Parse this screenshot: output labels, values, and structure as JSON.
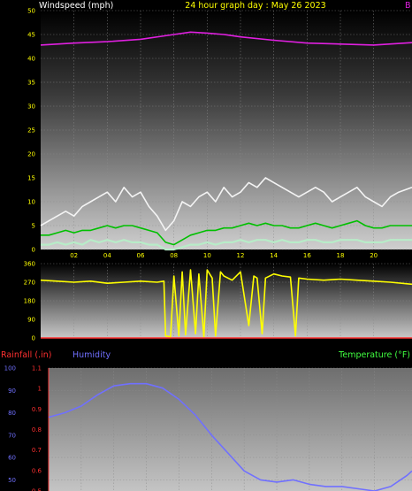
{
  "header": {
    "left_title": "Windspeed (mph)",
    "center_title": "24 hour graph day : May 26 2023",
    "right_fragment": "B"
  },
  "lower_header": {
    "rainfall_label": "Rainfall (.in)",
    "humidity_label": "Humidity",
    "temperature_label": "Temperature (°F)"
  },
  "colors": {
    "background": "#000000",
    "pressure": "#e020e0",
    "gust": "#f4f4f4",
    "average": "#00c000",
    "minimum": "#b8ecc8",
    "direction": "#ffff00",
    "humidity": "#7070ff",
    "rainfall": "#ff3030",
    "temperature": "#40ff40",
    "axis_text": "#ffff00"
  },
  "chart_data": [
    {
      "type": "line",
      "title": "24 hour graph day : May 26 2023",
      "ylabel": "Windspeed (mph)",
      "ylim": [
        0,
        50
      ],
      "yticks": [
        0,
        5,
        10,
        15,
        20,
        25,
        30,
        35,
        40,
        45,
        50
      ],
      "xlim": [
        0,
        22.3
      ],
      "xticks": [
        "02",
        "04",
        "06",
        "08",
        "10",
        "12",
        "14",
        "16",
        "18",
        "20"
      ],
      "grid": true,
      "series": [
        {
          "key": "pressure",
          "x": [
            0,
            2,
            4,
            6,
            8,
            9,
            10,
            11,
            12,
            14,
            16,
            18,
            20,
            22.3
          ],
          "values": [
            42.8,
            43.2,
            43.5,
            44,
            45,
            45.5,
            45.3,
            45,
            44.5,
            43.8,
            43.2,
            43,
            42.8,
            43.3
          ]
        },
        {
          "key": "gust",
          "x": [
            0,
            0.5,
            1,
            1.5,
            2,
            2.5,
            3,
            3.5,
            4,
            4.5,
            5,
            5.5,
            6,
            6.5,
            7,
            7.5,
            8,
            8.5,
            9,
            9.5,
            10,
            10.5,
            11,
            11.5,
            12,
            12.5,
            13,
            13.5,
            14,
            14.5,
            15,
            15.5,
            16,
            16.5,
            17,
            17.5,
            18,
            18.5,
            19,
            19.5,
            20,
            20.5,
            21,
            21.5,
            22.3
          ],
          "values": [
            5,
            6,
            7,
            8,
            7,
            9,
            10,
            11,
            12,
            10,
            13,
            11,
            12,
            9,
            7,
            4,
            6,
            10,
            9,
            11,
            12,
            10,
            13,
            11,
            12,
            14,
            13,
            15,
            14,
            13,
            12,
            11,
            12,
            13,
            12,
            10,
            11,
            12,
            13,
            11,
            10,
            9,
            11,
            12,
            13
          ]
        },
        {
          "key": "average",
          "x": [
            0,
            0.5,
            1,
            1.5,
            2,
            2.5,
            3,
            3.5,
            4,
            4.5,
            5,
            5.5,
            6,
            6.5,
            7,
            7.5,
            8,
            8.5,
            9,
            9.5,
            10,
            10.5,
            11,
            11.5,
            12,
            12.5,
            13,
            13.5,
            14,
            14.5,
            15,
            15.5,
            16,
            16.5,
            17,
            17.5,
            18,
            18.5,
            19,
            19.5,
            20,
            20.5,
            21,
            21.5,
            22.3
          ],
          "values": [
            3,
            3,
            3.5,
            4,
            3.5,
            4,
            4,
            4.5,
            5,
            4.5,
            5,
            5,
            4.5,
            4,
            3.5,
            1.5,
            1,
            2,
            3,
            3.5,
            4,
            4,
            4.5,
            4.5,
            5,
            5.5,
            5,
            5.5,
            5,
            5,
            4.5,
            4.5,
            5,
            5.5,
            5,
            4.5,
            5,
            5.5,
            6,
            5,
            4.5,
            4.5,
            5,
            5,
            5
          ]
        },
        {
          "key": "minimum",
          "x": [
            0,
            0.5,
            1,
            1.5,
            2,
            2.5,
            3,
            3.5,
            4,
            4.5,
            5,
            5.5,
            6,
            6.5,
            7,
            7.5,
            8,
            8.5,
            9,
            9.5,
            10,
            10.5,
            11,
            11.5,
            12,
            12.5,
            13,
            13.5,
            14,
            14.5,
            15,
            15.5,
            16,
            16.5,
            17,
            17.5,
            18,
            18.5,
            19,
            19.5,
            20,
            20.5,
            21,
            21.5,
            22.3
          ],
          "values": [
            1,
            1,
            1.5,
            1,
            1.5,
            1,
            2,
            1.5,
            2,
            1.5,
            2,
            1.5,
            1.5,
            1,
            1,
            0,
            0,
            0.5,
            1,
            1,
            1.5,
            1,
            1.5,
            1.5,
            2,
            1.5,
            2,
            2,
            1.5,
            2,
            1.5,
            1.5,
            2,
            2,
            1.5,
            1.5,
            2,
            2,
            2,
            1.5,
            1.5,
            1.5,
            2,
            2,
            2
          ]
        }
      ]
    },
    {
      "type": "line",
      "title": "",
      "ylabel": "",
      "ylim": [
        0,
        360
      ],
      "yticks": [
        0,
        90,
        180,
        270,
        360
      ],
      "xlim": [
        0,
        22.3
      ],
      "grid": true,
      "series": [
        {
          "key": "direction",
          "x": [
            0,
            1,
            2,
            3,
            4,
            5,
            6,
            7,
            7.4,
            7.5,
            7.8,
            8,
            8.3,
            8.5,
            8.7,
            9,
            9.3,
            9.5,
            9.8,
            10,
            10.3,
            10.5,
            10.8,
            11,
            11.5,
            12,
            12.5,
            12.8,
            13,
            13.3,
            13.5,
            14,
            14.5,
            15,
            15.3,
            15.5,
            16,
            17,
            18,
            19,
            20,
            21,
            22.3
          ],
          "values": [
            280,
            275,
            270,
            275,
            265,
            270,
            275,
            270,
            275,
            10,
            5,
            300,
            10,
            320,
            15,
            330,
            20,
            310,
            5,
            330,
            290,
            10,
            320,
            300,
            280,
            320,
            60,
            300,
            290,
            20,
            290,
            310,
            300,
            295,
            10,
            290,
            285,
            280,
            285,
            280,
            275,
            270,
            260
          ]
        },
        {
          "key": "rainfall",
          "x": [
            0,
            22.3
          ],
          "values": [
            0,
            0
          ]
        }
      ]
    },
    {
      "type": "line",
      "title": "",
      "ylabel": "Humidity",
      "ylim": [
        45,
        100
      ],
      "yticks": [
        50,
        60,
        70,
        80,
        90,
        100
      ],
      "xlim": [
        0,
        22.3
      ],
      "grid": true,
      "series": [
        {
          "key": "humidity",
          "x": [
            0,
            1,
            2,
            3,
            4,
            5,
            6,
            7,
            8,
            9,
            10,
            11,
            12,
            13,
            14,
            15,
            16,
            17,
            18,
            19,
            20,
            21,
            22,
            22.3
          ],
          "values": [
            78,
            80,
            83,
            88,
            92,
            93,
            93,
            91,
            86,
            79,
            70,
            62,
            54,
            50,
            49,
            50,
            48,
            47,
            47,
            46,
            45,
            47,
            52,
            54
          ]
        }
      ]
    },
    {
      "type": "line",
      "title": "",
      "ylabel": "Rainfall (.in)",
      "ylim": [
        0.5,
        1.1
      ],
      "yticks": [
        0.5,
        0.6,
        0.7,
        0.8,
        0.9,
        1,
        1.1
      ],
      "series": []
    }
  ]
}
